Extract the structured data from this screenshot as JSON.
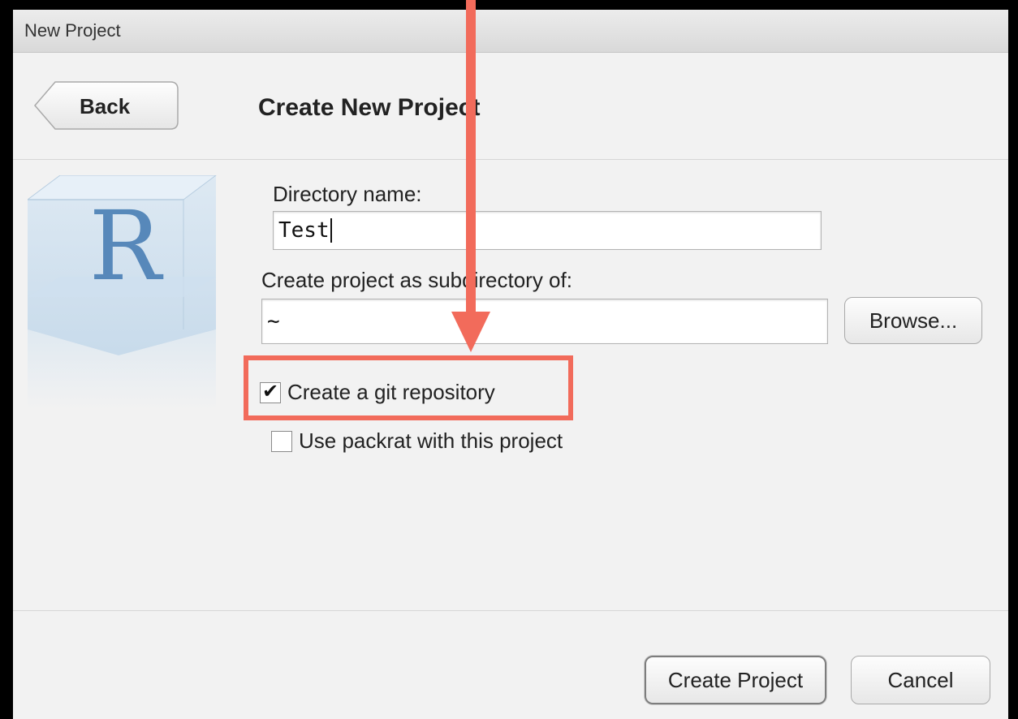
{
  "window": {
    "title": "New Project"
  },
  "header": {
    "back_label": "Back",
    "page_title": "Create New Project"
  },
  "logo": {
    "letter": "R"
  },
  "form": {
    "directory_label": "Directory name:",
    "directory_value": "Test",
    "subdir_label": "Create project as subdirectory of:",
    "subdir_value": "~",
    "browse_label": "Browse...",
    "git_label": "Create a git repository",
    "git_checked": true,
    "packrat_label": "Use packrat with this project",
    "packrat_checked": false
  },
  "footer": {
    "create_label": "Create Project",
    "cancel_label": "Cancel"
  },
  "colors": {
    "annotation": "#f26b5b",
    "r_logo": "#4a7fb5",
    "dialog_bg": "#f2f2f2"
  }
}
